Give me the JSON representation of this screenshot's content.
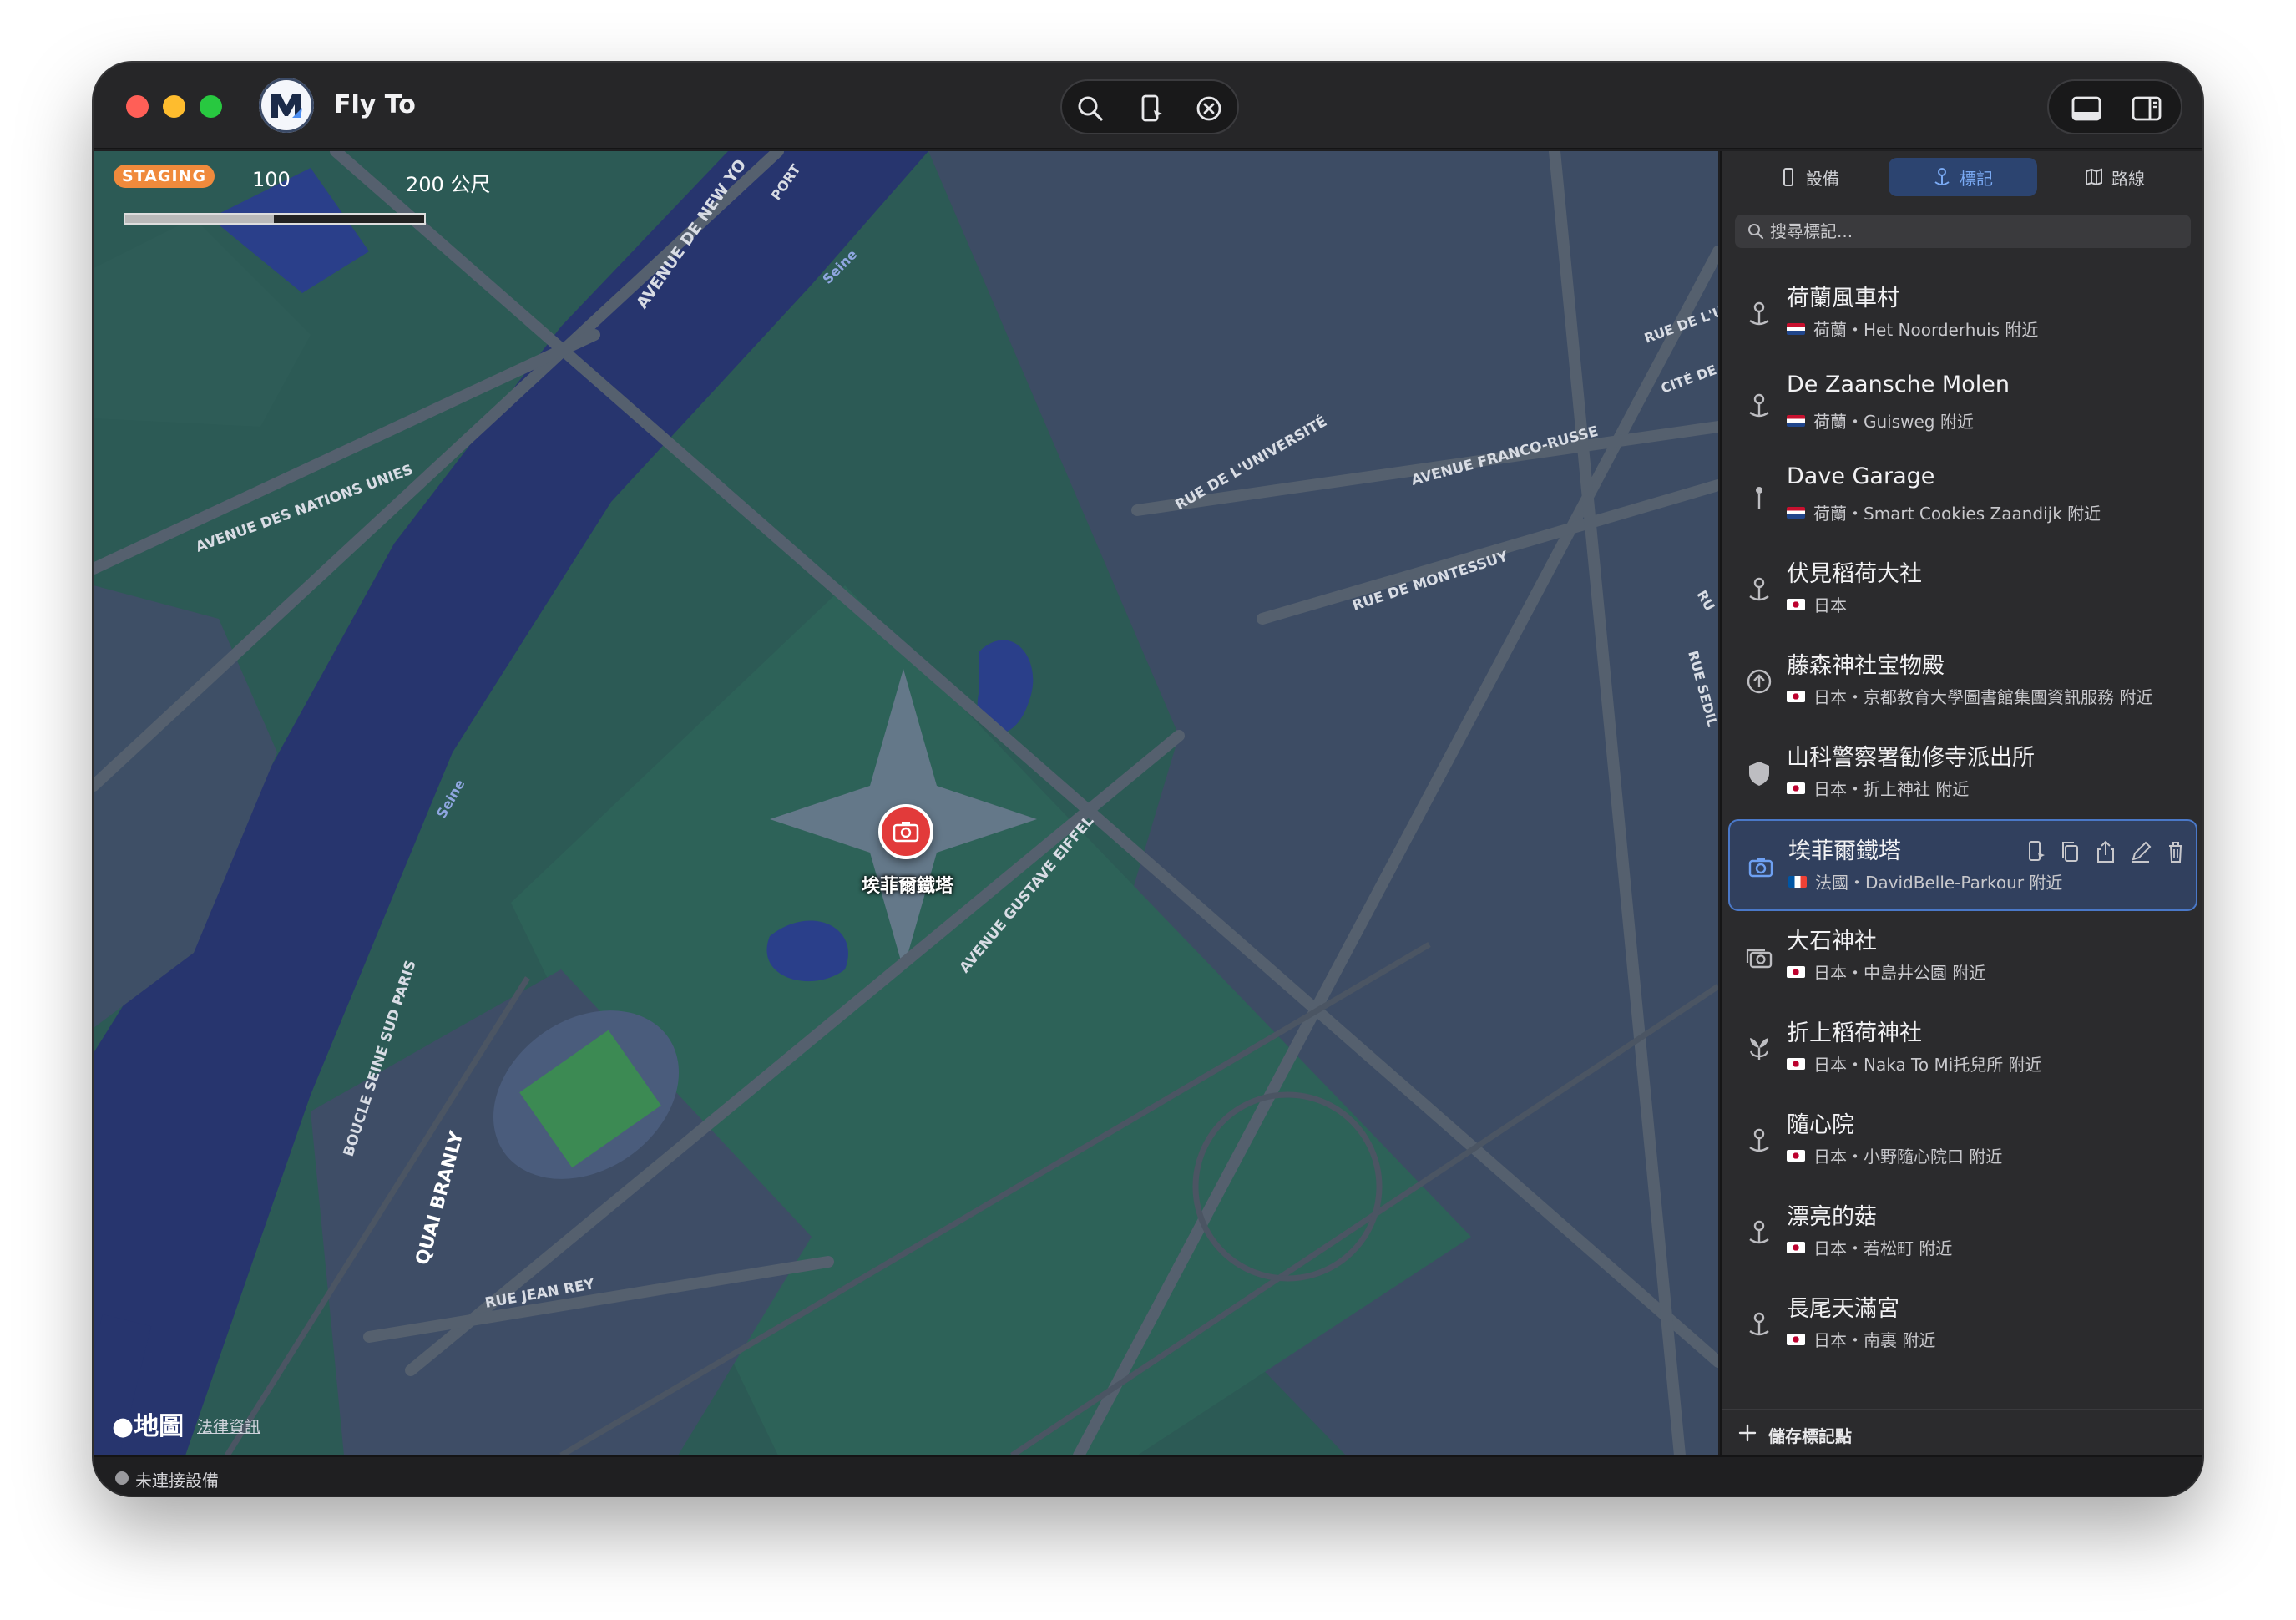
{
  "app": {
    "title": "Fly To"
  },
  "map": {
    "env_badge": "STAGING",
    "scale_left": "100",
    "scale_right": "200 公尺",
    "pin_label": "埃菲爾鐵塔",
    "attribution_logo": "地圖",
    "legal_link": "法律資訊",
    "street_labels": [
      "AVENUE DE NEW YO",
      "PORT",
      "Seine",
      "AVENUE DES NATIONS UNIES",
      "RUE DE L'UNIVERSITÉ",
      "AVENUE FRANCO-RUSSE",
      "RUE DE L'U",
      "CITÉ DE",
      "RUE DE MONTESSUY",
      "RU",
      "RUE SEDIL",
      "Seine",
      "AVENUE GUSTAVE EIFFEL",
      "BOUCLE SEINE SUD PARIS",
      "QUAI BRANLY",
      "RUE JEAN REY"
    ]
  },
  "sidebar": {
    "tabs": [
      {
        "label": "設備",
        "icon": "phone-icon"
      },
      {
        "label": "標記",
        "icon": "pin-icon",
        "active": true
      },
      {
        "label": "路線",
        "icon": "map-icon"
      }
    ],
    "search_placeholder": "搜尋標記...",
    "items": [
      {
        "title": "荷蘭風車村",
        "flag": "nl",
        "subtitle": "荷蘭・Het Noorderhuis 附近",
        "icon": "pin-icon"
      },
      {
        "title": "De Zaansche Molen",
        "flag": "nl",
        "subtitle": "荷蘭・Guisweg 附近",
        "icon": "pin-icon"
      },
      {
        "title": "Dave Garage",
        "flag": "nl",
        "subtitle": "荷蘭・Smart Cookies Zaandijk 附近",
        "icon": "map-pin-icon"
      },
      {
        "title": "伏見稻荷大社",
        "flag": "jp",
        "subtitle": "日本",
        "icon": "pin-icon"
      },
      {
        "title": "藤森神社宝物殿",
        "flag": "jp",
        "subtitle": "日本・京都教育大學圖書館集團資訊服務 附近",
        "icon": "upload-circle-icon"
      },
      {
        "title": "山科警察署勧修寺派出所",
        "flag": "jp",
        "subtitle": "日本・折上神社 附近",
        "icon": "shield-icon"
      },
      {
        "title": "埃菲爾鐵塔",
        "flag": "fr",
        "subtitle": "法國・DavidBelle-Parkour 附近",
        "icon": "camera-icon",
        "selected": true
      },
      {
        "title": "大石神社",
        "flag": "jp",
        "subtitle": "日本・中島井公園 附近",
        "icon": "cameras-icon"
      },
      {
        "title": "折上稻荷神社",
        "flag": "jp",
        "subtitle": "日本・Naka To Mi托兒所 附近",
        "icon": "flower-icon"
      },
      {
        "title": "隨心院",
        "flag": "jp",
        "subtitle": "日本・小野隨心院口 附近",
        "icon": "pin-icon"
      },
      {
        "title": "漂亮的菇",
        "flag": "jp",
        "subtitle": "日本・若松町 附近",
        "icon": "pin-icon"
      },
      {
        "title": "長尾天滿宮",
        "flag": "jp",
        "subtitle": "日本・南裏 附近",
        "icon": "pin-icon"
      }
    ],
    "footer_label": "儲存標記點"
  },
  "status": {
    "text": "未連接設備"
  },
  "colors": {
    "accent": "#4a78c8",
    "badge": "#f08a3c",
    "pin": "#e23a3a"
  }
}
